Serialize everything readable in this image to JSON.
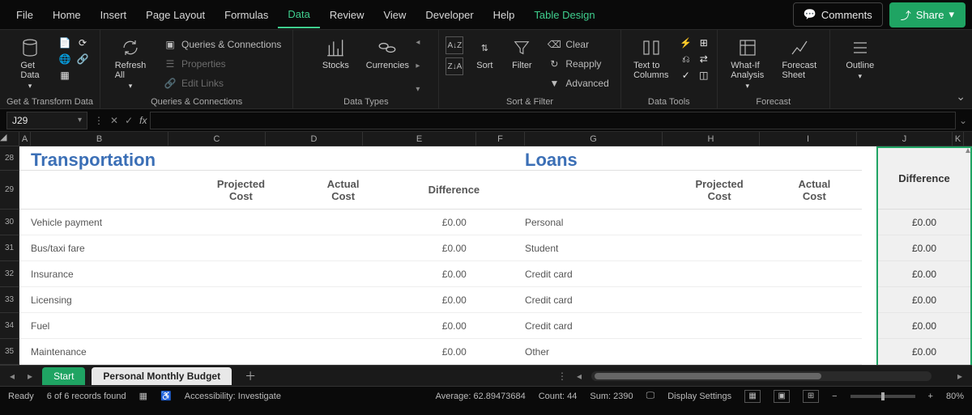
{
  "menu": {
    "file": "File",
    "home": "Home",
    "insert": "Insert",
    "page_layout": "Page Layout",
    "formulas": "Formulas",
    "data": "Data",
    "review": "Review",
    "view": "View",
    "developer": "Developer",
    "help": "Help",
    "table_design": "Table Design"
  },
  "top_buttons": {
    "comments": "Comments",
    "share": "Share"
  },
  "ribbon": {
    "get_data": "Get\nData",
    "refresh_all": "Refresh\nAll",
    "queries_conn": "Queries & Connections",
    "properties": "Properties",
    "edit_links": "Edit Links",
    "stocks": "Stocks",
    "currencies": "Currencies",
    "sort": "Sort",
    "filter": "Filter",
    "clear": "Clear",
    "reapply": "Reapply",
    "advanced": "Advanced",
    "text_to_columns": "Text to\nColumns",
    "whatif": "What-If\nAnalysis",
    "forecast_sheet": "Forecast\nSheet",
    "outline": "Outline",
    "groups": {
      "g1": "Get & Transform Data",
      "g2": "Queries & Connections",
      "g3": "Data Types",
      "g4": "Sort & Filter",
      "g5": "Data Tools",
      "g6": "Forecast"
    }
  },
  "name_box": "J29",
  "columns": [
    "A",
    "B",
    "C",
    "D",
    "E",
    "F",
    "G",
    "H",
    "I",
    "J",
    "K"
  ],
  "rows": [
    "28",
    "29",
    "30",
    "31",
    "32",
    "33",
    "34",
    "35"
  ],
  "sections": {
    "transportation": {
      "title": "Transportation",
      "headers": {
        "projected": "Projected\nCost",
        "actual": "Actual\nCost",
        "difference": "Difference"
      },
      "items": [
        {
          "name": "Vehicle payment",
          "diff": "£0.00"
        },
        {
          "name": "Bus/taxi fare",
          "diff": "£0.00"
        },
        {
          "name": "Insurance",
          "diff": "£0.00"
        },
        {
          "name": "Licensing",
          "diff": "£0.00"
        },
        {
          "name": "Fuel",
          "diff": "£0.00"
        },
        {
          "name": "Maintenance",
          "diff": "£0.00"
        }
      ]
    },
    "loans": {
      "title": "Loans",
      "headers": {
        "projected": "Projected\nCost",
        "actual": "Actual\nCost",
        "difference": "Difference"
      },
      "items": [
        {
          "name": "Personal",
          "diff": "£0.00"
        },
        {
          "name": "Student",
          "diff": "£0.00"
        },
        {
          "name": "Credit card",
          "diff": "£0.00"
        },
        {
          "name": "Credit card",
          "diff": "£0.00"
        },
        {
          "name": "Credit card",
          "diff": "£0.00"
        },
        {
          "name": "Other",
          "diff": "£0.00"
        }
      ]
    }
  },
  "sheet_tabs": {
    "start": "Start",
    "budget": "Personal Monthly Budget"
  },
  "status": {
    "ready": "Ready",
    "records": "6 of 6 records found",
    "accessibility": "Accessibility: Investigate",
    "average": "Average: 62.89473684",
    "count": "Count: 44",
    "sum": "Sum: 2390",
    "display": "Display Settings",
    "zoom": "80%"
  }
}
